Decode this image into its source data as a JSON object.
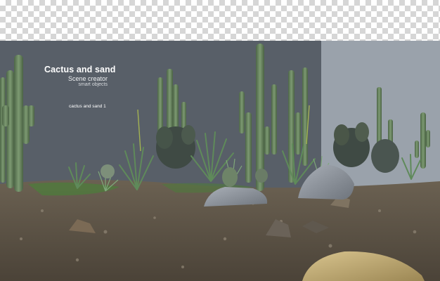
{
  "overlay": {
    "title": "Cactus and sand",
    "subtitle": "Scene creator",
    "subsubtitle": "smart objects",
    "caption": "cactus and sand 1"
  },
  "colors": {
    "backdrop": "#585f68",
    "backdrop_right": "#9aa2ab",
    "ground": "#5b5347",
    "cactus": "#5f7a58",
    "rock": "#8e949b"
  },
  "icons": [
    "checkerboard-transparency",
    "cactus",
    "agave",
    "rock",
    "grass"
  ]
}
